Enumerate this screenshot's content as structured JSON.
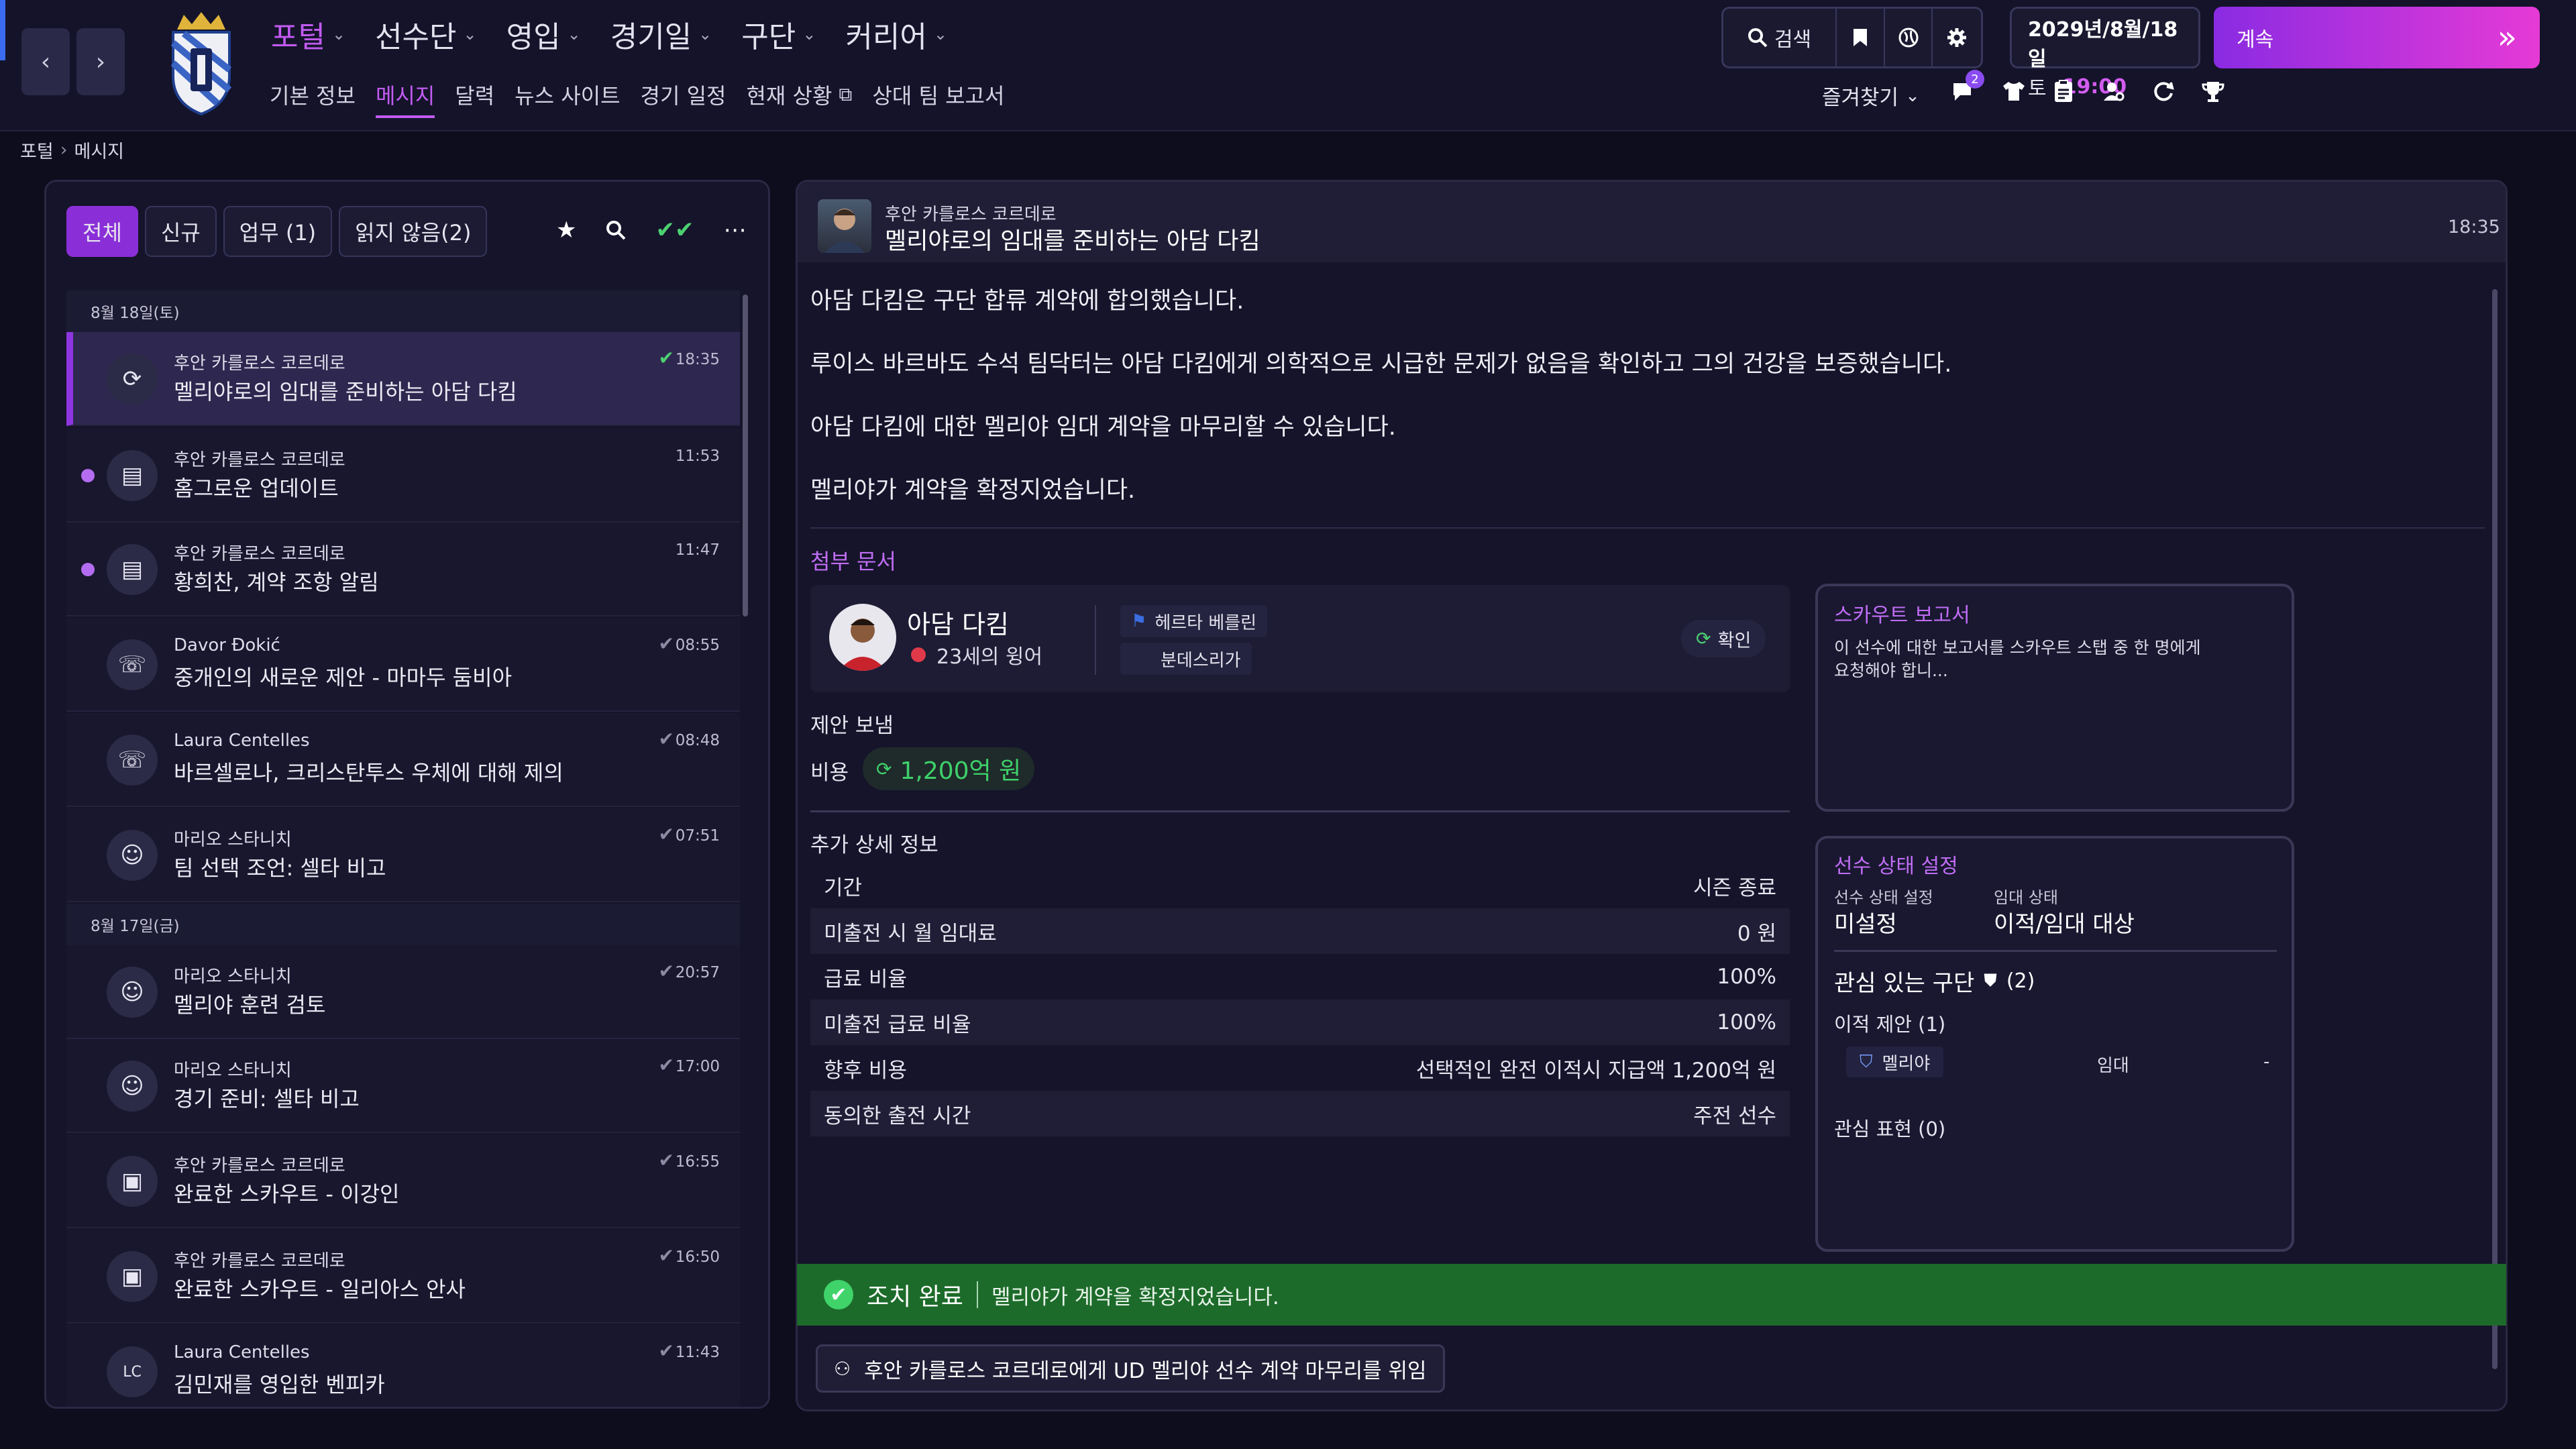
{
  "topbar": {
    "nav_back": "‹",
    "nav_forward": "›",
    "menus": [
      {
        "label": "포털",
        "active": true
      },
      {
        "label": "선수단"
      },
      {
        "label": "영입"
      },
      {
        "label": "경기일"
      },
      {
        "label": "구단"
      },
      {
        "label": "커리어"
      }
    ],
    "submenus": [
      "기본 정보",
      "메시지",
      "달력",
      "뉴스 사이트",
      "경기 일정",
      "현재 상황",
      "상대 팀 보고서"
    ],
    "search_label": "검색",
    "date_line1": "2029년/8월/18일",
    "date_day": "토",
    "date_time": "19:00",
    "continue_label": "계속",
    "favorites_label": "즐겨찾기",
    "chat_badge": "2"
  },
  "breadcrumb": {
    "root": "포털",
    "current": "메시지"
  },
  "inbox": {
    "tabs": [
      "전체",
      "신규",
      "업무 (1)",
      "읽지 않음(2)"
    ],
    "groups": [
      {
        "date": "8월 18일(토)",
        "messages": [
          {
            "sender": "후안 카를로스 코르데로",
            "subject": "멜리야로의 임대를 준비하는 아담 다킴",
            "time": "18:35",
            "icon": "refresh-icon"
          },
          {
            "sender": "후안 카를로스 코르데로",
            "subject": "홈그로운 업데이트",
            "time": "11:53",
            "icon": "document-icon"
          },
          {
            "sender": "후안 카를로스 코르데로",
            "subject": "황희찬, 계약 조항 알림",
            "time": "11:47",
            "icon": "document-icon"
          },
          {
            "sender": "Davor Đokić",
            "subject": "중개인의 새로운 제안 - 마마두 둠비아",
            "time": "08:55",
            "icon": "agent-icon"
          },
          {
            "sender": "Laura Centelles",
            "subject": "바르셀로나, 크리스탄투스 우체에 대해 제의",
            "time": "08:48",
            "icon": "agent-icon"
          },
          {
            "sender": "마리오 스타니치",
            "subject": "팀 선택 조언: 셀타 비고",
            "time": "07:51",
            "icon": "team-icon"
          }
        ]
      },
      {
        "date": "8월 17일(금)",
        "messages": [
          {
            "sender": "마리오 스타니치",
            "subject": "멜리야 훈련 검토",
            "time": "20:57",
            "icon": "team-icon"
          },
          {
            "sender": "마리오 스타니치",
            "subject": "경기 준비: 셀타 비고",
            "time": "17:00",
            "icon": "team-icon"
          },
          {
            "sender": "후안 카를로스 코르데로",
            "subject": "완료한 스카우트 - 이강인",
            "time": "16:55",
            "icon": "briefcase-icon"
          },
          {
            "sender": "후안 카를로스 코르데로",
            "subject": "완료한 스카우트 - 일리아스 안사",
            "time": "16:50",
            "icon": "briefcase-icon"
          },
          {
            "sender": "Laura Centelles",
            "subject": "김민재를 영입한 벤피카",
            "time": "11:43",
            "icon": "LC"
          }
        ]
      }
    ]
  },
  "message": {
    "sender": "후안 카를로스 코르데로",
    "subject": "멜리야로의 임대를 준비하는 아담 다킴",
    "time": "18:35",
    "paragraphs": [
      "아담 다킴은 구단 합류 계약에 합의했습니다.",
      "루이스 바르바도 수석 팀닥터는 아담 다킴에게 의학적으로 시급한 문제가 없음을 확인하고 그의 건강을 보증했습니다.",
      "아담 다킴에 대한 멜리야 임대 계약을 마무리할 수 있습니다.",
      "멜리야가 계약을 확정지었습니다."
    ],
    "attachments_label": "첨부 문서",
    "player": {
      "name": "아담 다킴",
      "desc": "23세의 윙어",
      "club": "헤르타 베를린",
      "league": "분데스리가",
      "confirm_label": "확인"
    },
    "offer_label": "제안 보냄",
    "cost_label": "비용",
    "cost_value": "1,200억 원",
    "details_label": "추가 상세 정보",
    "details": [
      {
        "key": "기간",
        "value": "시즌 종료"
      },
      {
        "key": "미출전 시 월 임대료",
        "value": "0 원"
      },
      {
        "key": "급료 비율",
        "value": "100%"
      },
      {
        "key": "미출전 급료 비율",
        "value": "100%"
      },
      {
        "key": "향후 비용",
        "value": "선택적인 완전 이적시 지급액 1,200억 원"
      },
      {
        "key": "동의한 출전 시간",
        "value": "주전 선수"
      }
    ],
    "scout": {
      "title": "스카우트 보고서",
      "text_line1": "이 선수에 대한 보고서를 스카우트 스탭 중 한 명에게",
      "text_line2": "요청해야 합니..."
    },
    "status": {
      "title": "선수 상태 설정",
      "status_label": "선수 상태 설정",
      "status_value": "미설정",
      "loan_label": "임대 상태",
      "loan_value": "이적/임대 대상",
      "interested_label": "관심 있는 구단",
      "interested_count": "(2)",
      "transfer_offers_label": "이적 제안 (1)",
      "offer_club": "멜리야",
      "offer_type": "임대",
      "offer_extra": "-",
      "interest_label": "관심 표현 (0)"
    },
    "action_done_label": "조치 완료",
    "action_done_text": "멜리야가 계약을 확정지었습니다.",
    "delegate_label": "후안 카를로스 코르데로에게 UD 멜리야 선수 계약 마무리를 위임"
  },
  "colors": {
    "accent": "#8a2fd8",
    "menu_active": "#c25bf2",
    "success": "#1e7a2d",
    "cost_green": "#3ed16a"
  }
}
